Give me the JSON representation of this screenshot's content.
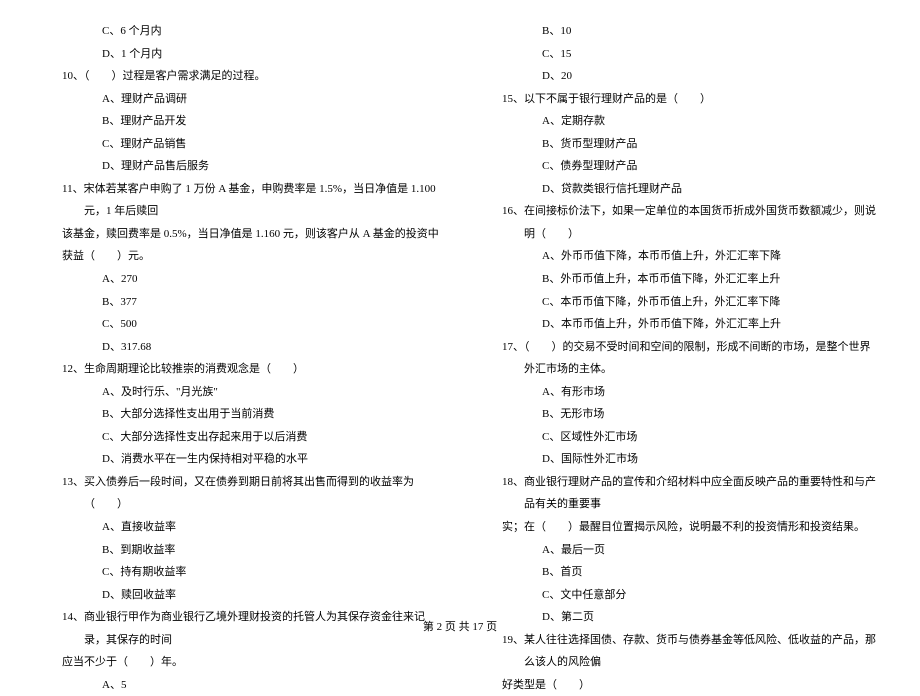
{
  "left": {
    "opt9c": "C、6 个月内",
    "opt9d": "D、1 个月内",
    "q10": "10、（　　）过程是客户需求满足的过程。",
    "opt10a": "A、理财产品调研",
    "opt10b": "B、理财产品开发",
    "opt10c": "C、理财产品销售",
    "opt10d": "D、理财产品售后服务",
    "q11": "11、宋体若某客户申购了 1 万份 A 基金，申购费率是 1.5%，当日净值是 1.100 元，1 年后赎回",
    "q11b": "该基金，赎回费率是 0.5%，当日净值是 1.160 元，则该客户从 A 基金的投资中获益（　　）元。",
    "opt11a": "A、270",
    "opt11b": "B、377",
    "opt11c": "C、500",
    "opt11d": "D、317.68",
    "q12": "12、生命周期理论比较推崇的消费观念是（　　）",
    "opt12a": "A、及时行乐、\"月光族\"",
    "opt12b": "B、大部分选择性支出用于当前消费",
    "opt12c": "C、大部分选择性支出存起来用于以后消费",
    "opt12d": "D、消费水平在一生内保持相对平稳的水平",
    "q13": "13、买入债券后一段时间，又在债券到期日前将其出售而得到的收益率为（　　）",
    "opt13a": "A、直接收益率",
    "opt13b": "B、到期收益率",
    "opt13c": "C、持有期收益率",
    "opt13d": "D、赎回收益率",
    "q14": "14、商业银行甲作为商业银行乙境外理财投资的托管人为其保存资金往来记录，其保存的时间",
    "q14b": "应当不少于（　　）年。",
    "opt14a": "A、5"
  },
  "right": {
    "opt14b": "B、10",
    "opt14c": "C、15",
    "opt14d": "D、20",
    "q15": "15、以下不属于银行理财产品的是（　　）",
    "opt15a": "A、定期存款",
    "opt15b": "B、货币型理财产品",
    "opt15c": "C、债券型理财产品",
    "opt15d": "D、贷款类银行信托理财产品",
    "q16": "16、在间接标价法下，如果一定单位的本国货币折成外国货币数额减少，则说明（　　）",
    "opt16a": "A、外币币值下降，本币币值上升，外汇汇率下降",
    "opt16b": "B、外币币值上升，本币币值下降，外汇汇率上升",
    "opt16c": "C、本币币值下降，外币币值上升，外汇汇率下降",
    "opt16d": "D、本币币值上升，外币币值下降，外汇汇率上升",
    "q17": "17、（　　）的交易不受时间和空间的限制，形成不间断的市场，是整个世界外汇市场的主体。",
    "opt17a": "A、有形市场",
    "opt17b": "B、无形市场",
    "opt17c": "C、区域性外汇市场",
    "opt17d": "D、国际性外汇市场",
    "q18": "18、商业银行理财产品的宣传和介绍材料中应全面反映产品的重要特性和与产品有关的重要事",
    "q18b": "实；在（　　）最醒目位置揭示风险，说明最不利的投资情形和投资结果。",
    "opt18a": "A、最后一页",
    "opt18b": "B、首页",
    "opt18c": "C、文中任意部分",
    "opt18d": "D、第二页",
    "q19": "19、某人往往选择国债、存款、货币与债券基金等低风险、低收益的产品，那么该人的风险偏",
    "q19b": "好类型是（　　）"
  },
  "footer": "第 2 页 共 17 页"
}
